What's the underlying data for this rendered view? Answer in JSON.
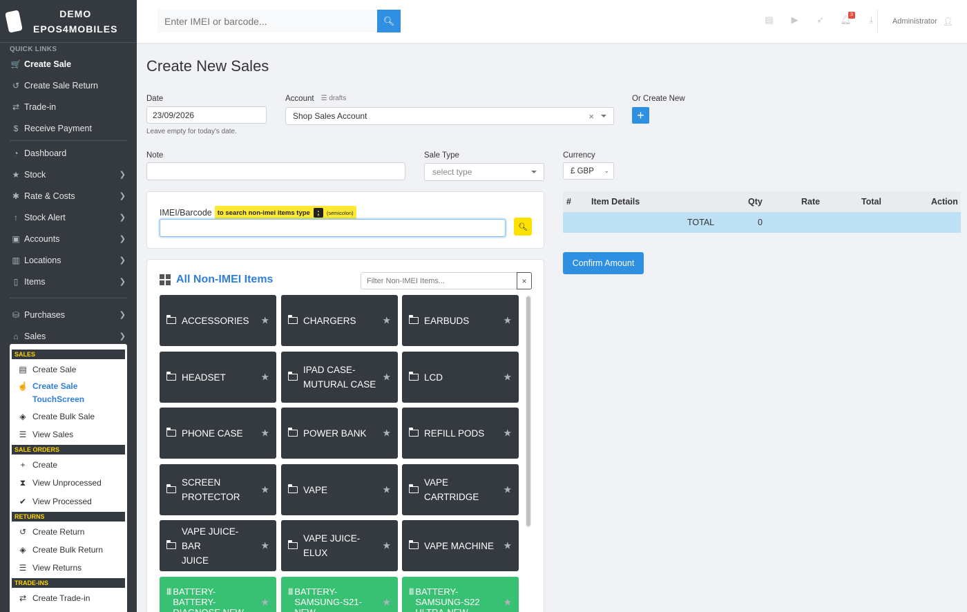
{
  "brand": {
    "line1": "DEMO",
    "line2": "EPOS4MOBILES"
  },
  "sidebar": {
    "quick_links_label": "QUICK LINKS",
    "items": [
      {
        "label": "Create Sale",
        "icon": "cart-icon",
        "glyph": "🛒",
        "active": true
      },
      {
        "label": "Create Sale Return",
        "icon": "undo-icon",
        "glyph": "↺"
      },
      {
        "label": "Trade-in",
        "icon": "exchange-icon",
        "glyph": "⇄"
      },
      {
        "label": "Receive Payment",
        "icon": "dollar-icon",
        "glyph": "$"
      },
      {
        "label": "Dashboard",
        "icon": "dashboard-icon",
        "glyph": "◔"
      },
      {
        "label": "Stock",
        "icon": "star-icon",
        "glyph": "★"
      },
      {
        "label": "Rate & Costs",
        "icon": "asterisk-icon",
        "glyph": "✱"
      },
      {
        "label": "Stock Alert",
        "icon": "arrow-up-icon",
        "glyph": "↑"
      },
      {
        "label": "Accounts",
        "icon": "address-book-icon",
        "glyph": "▣"
      },
      {
        "label": "Locations",
        "icon": "map-icon",
        "glyph": "▥"
      },
      {
        "label": "Items",
        "icon": "mobile-icon",
        "glyph": "▯"
      },
      {
        "label": "Purchases",
        "icon": "inbox-icon",
        "glyph": "⛁"
      },
      {
        "label": "Sales",
        "icon": "store-icon",
        "glyph": "⌂"
      }
    ]
  },
  "submenu": {
    "sales_header": "SALES",
    "create_sale": "Create Sale",
    "create_sale_touch_1": "Create Sale",
    "create_sale_touch_2": "TouchScreen",
    "create_bulk_sale": "Create Bulk Sale",
    "view_sales": "View Sales",
    "sale_orders_header": "SALE ORDERS",
    "create": "Create",
    "view_unprocessed": "View Unprocessed",
    "view_processed": "View Processed",
    "returns_header": "RETURNS",
    "create_return": "Create Return",
    "create_bulk_return": "Create Bulk Return",
    "view_returns": "View Returns",
    "tradeins_header": "TRADE-INS",
    "create_tradein": "Create Trade-in"
  },
  "topbar": {
    "search_placeholder": "Enter IMEI or barcode...",
    "notification_count": "3",
    "user": "Administrator"
  },
  "page": {
    "title": "Create New Sales",
    "date_label": "Date",
    "date_value": "23/09/2026",
    "date_help": "Leave empty for today's date.",
    "account_label": "Account",
    "drafts_label": "drafts",
    "account_value": "Shop Sales Account",
    "or_create_new": "Or Create New",
    "note_label": "Note",
    "sale_type_label": "Sale Type",
    "sale_type_placeholder": "select type",
    "currency_label": "Currency",
    "currency_value": "£ GBP",
    "imei_label": "IMEI/Barcode",
    "imei_hint": "to search non-imei items type",
    "semicolon_key": ";",
    "semicolon_text": "(semicolon)",
    "items_title": "All Non-IMEI Items",
    "filter_placeholder": "Filter Non-IMEI Items...",
    "confirm_label": "Confirm Amount"
  },
  "categories": [
    {
      "line1": "ACCESSORIES",
      "line2": ""
    },
    {
      "line1": "CHARGERS",
      "line2": ""
    },
    {
      "line1": "EARBUDS",
      "line2": ""
    },
    {
      "line1": "HEADSET",
      "line2": ""
    },
    {
      "line1": "IPAD CASE-",
      "line2": "MUTURAL CASE"
    },
    {
      "line1": "LCD",
      "line2": ""
    },
    {
      "line1": "PHONE CASE",
      "line2": ""
    },
    {
      "line1": "POWER BANK",
      "line2": ""
    },
    {
      "line1": "REFILL PODS",
      "line2": ""
    },
    {
      "line1": "SCREEN",
      "line2": "PROTECTOR"
    },
    {
      "line1": "VAPE",
      "line2": ""
    },
    {
      "line1": "VAPE",
      "line2": "CARTRIDGE"
    },
    {
      "line1": "VAPE JUICE-BAR",
      "line2": "JUICE"
    },
    {
      "line1": "VAPE JUICE-",
      "line2": "ELUX"
    },
    {
      "line1": "VAPE MACHINE",
      "line2": ""
    }
  ],
  "products": [
    {
      "line1": "BATTERY-",
      "line2": "BATTERY-",
      "line3": "DIAGNOSE NEW"
    },
    {
      "line1": "BATTERY-",
      "line2": "SAMSUNG-S21-",
      "line3": "NEW"
    },
    {
      "line1": "BATTERY-",
      "line2": "SAMSUNG-S22",
      "line3": "ULTRA-NEW"
    }
  ],
  "table": {
    "columns": [
      "#",
      "Item Details",
      "Qty",
      "Rate",
      "Total",
      "Action"
    ],
    "total_label": "TOTAL",
    "total_qty": "0"
  }
}
